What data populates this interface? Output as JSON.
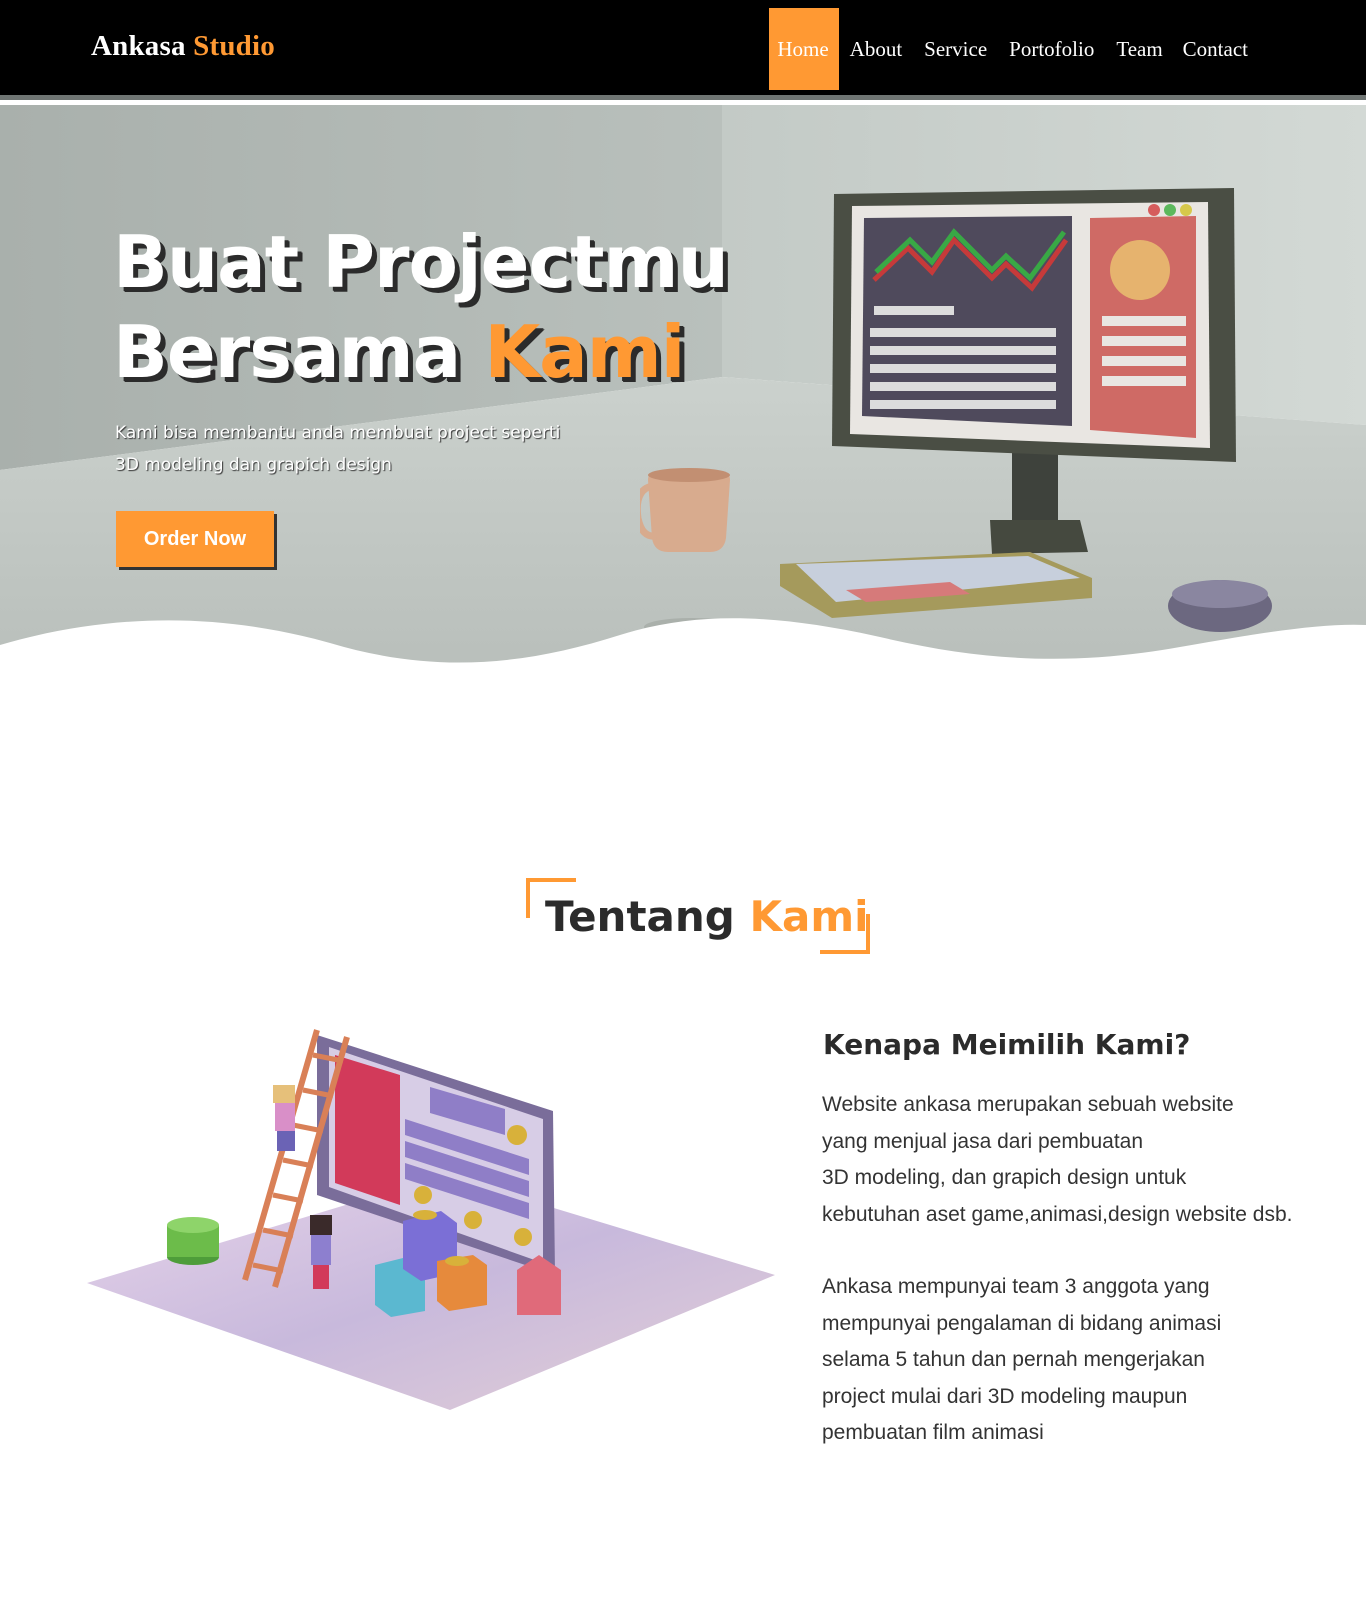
{
  "navbar": {
    "brand_main": "Ankasa",
    "brand_accent": "Studio",
    "items": [
      {
        "label": "Home",
        "active": true
      },
      {
        "label": "About",
        "active": false
      },
      {
        "label": "Service",
        "active": false
      },
      {
        "label": "Portofolio",
        "active": false
      },
      {
        "label": "Team",
        "active": false
      },
      {
        "label": "Contact",
        "active": false
      }
    ]
  },
  "hero": {
    "title_line1": "Buat Projectmu",
    "title_line2_main": "Bersama",
    "title_line2_accent": "Kami",
    "subtitle_line1": "Kami bisa membantu anda membuat project seperti",
    "subtitle_line2": "3D modeling dan grapich design",
    "cta_label": "Order Now"
  },
  "about": {
    "section_title_main": "Tentang",
    "section_title_accent": "Kami",
    "heading": "Kenapa Meimilih Kami?",
    "paragraph1_lines": [
      "Website ankasa merupakan sebuah website",
      "yang menjual jasa dari pembuatan",
      "3D modeling, dan grapich design untuk",
      "kebutuhan aset game,animasi,design website dsb."
    ],
    "paragraph2_lines": [
      "Ankasa mempunyai team 3 anggota yang",
      "mempunyai pengalaman di bidang animasi",
      "selama 5 tahun dan pernah mengerjakan",
      "project mulai dari 3D modeling maupun",
      "pembuatan film animasi"
    ]
  },
  "colors": {
    "accent": "#ff9933",
    "navbar_bg": "#000000",
    "text_dark": "#2b2b2b"
  },
  "icons": [
    "desk-computer-illustration",
    "isometric-builders-illustration"
  ]
}
